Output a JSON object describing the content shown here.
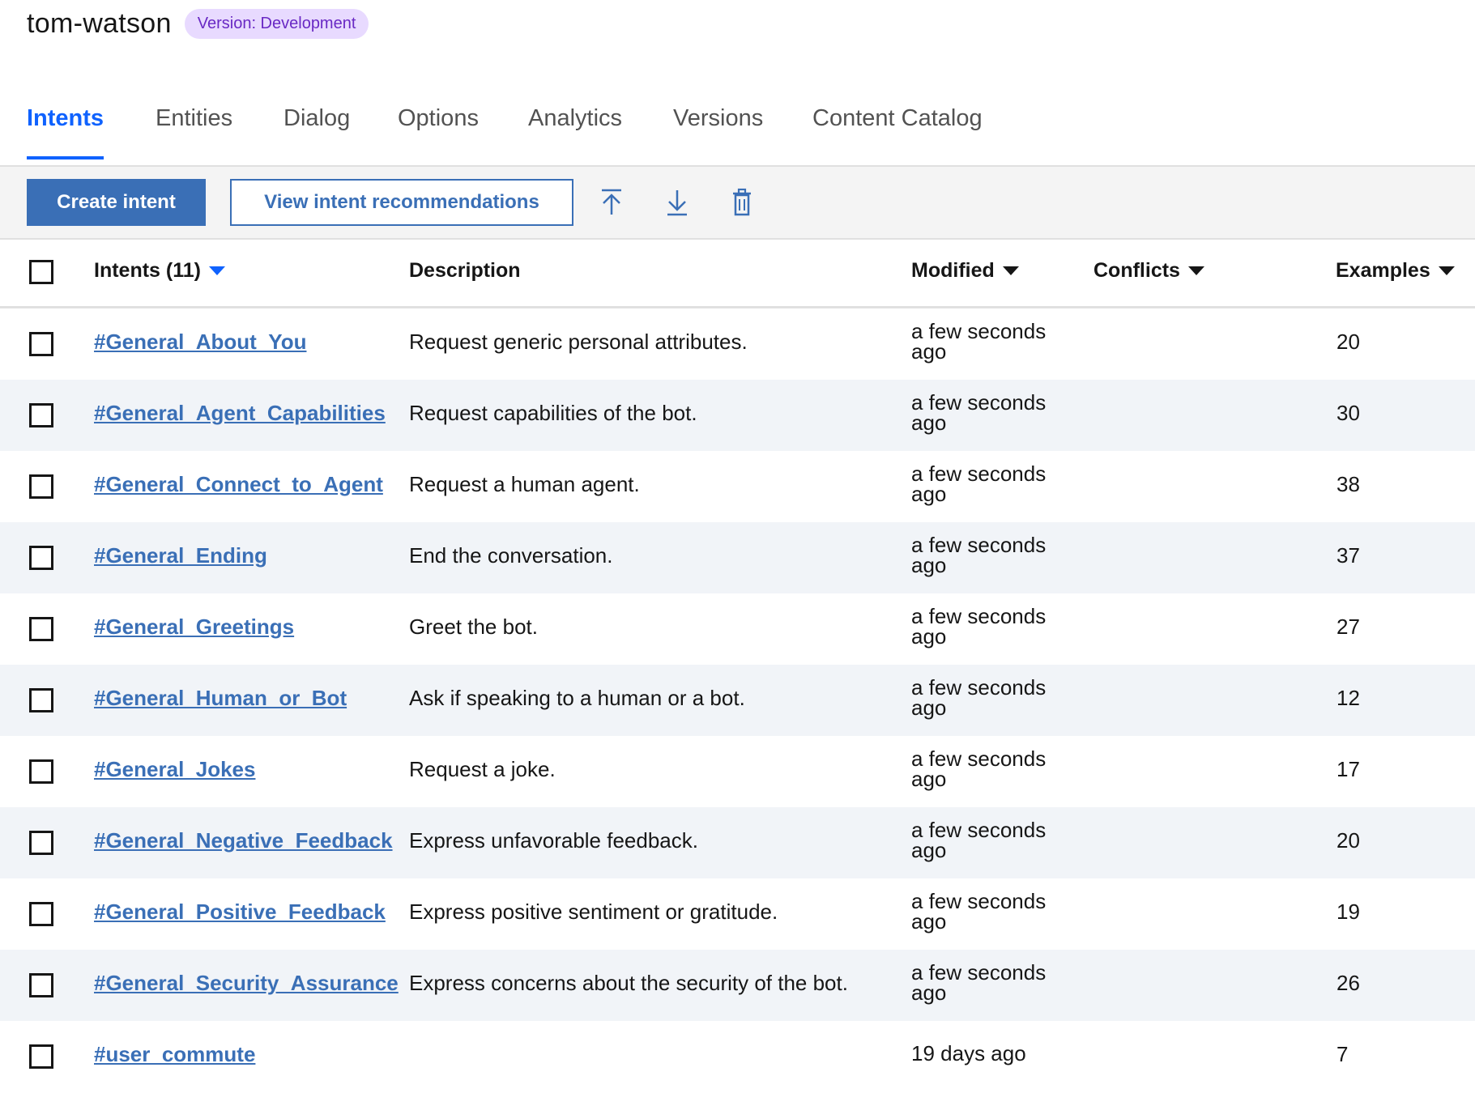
{
  "header": {
    "title": "tom-watson",
    "version_badge": "Version: Development"
  },
  "tabs": [
    {
      "label": "Intents",
      "active": true
    },
    {
      "label": "Entities",
      "active": false
    },
    {
      "label": "Dialog",
      "active": false
    },
    {
      "label": "Options",
      "active": false
    },
    {
      "label": "Analytics",
      "active": false
    },
    {
      "label": "Versions",
      "active": false
    },
    {
      "label": "Content Catalog",
      "active": false
    }
  ],
  "toolbar": {
    "create_label": "Create intent",
    "recommend_label": "View intent recommendations",
    "icons": [
      "upload-icon",
      "download-icon",
      "delete-icon"
    ]
  },
  "table": {
    "columns": {
      "intents": "Intents (11)",
      "description": "Description",
      "modified": "Modified",
      "conflicts": "Conflicts",
      "examples": "Examples"
    },
    "rows": [
      {
        "name": "#General_About_You",
        "description": "Request generic personal attributes.",
        "modified": "a few seconds ago",
        "examples": "20"
      },
      {
        "name": "#General_Agent_Capabilities",
        "description": "Request capabilities of the bot.",
        "modified": "a few seconds ago",
        "examples": "30"
      },
      {
        "name": "#General_Connect_to_Agent",
        "description": "Request a human agent.",
        "modified": "a few seconds ago",
        "examples": "38"
      },
      {
        "name": "#General_Ending",
        "description": "End the conversation.",
        "modified": "a few seconds ago",
        "examples": "37"
      },
      {
        "name": "#General_Greetings",
        "description": "Greet the bot.",
        "modified": "a few seconds ago",
        "examples": "27"
      },
      {
        "name": "#General_Human_or_Bot",
        "description": "Ask if speaking to a human or a bot.",
        "modified": "a few seconds ago",
        "examples": "12"
      },
      {
        "name": "#General_Jokes",
        "description": "Request a joke.",
        "modified": "a few seconds ago",
        "examples": "17"
      },
      {
        "name": "#General_Negative_Feedback",
        "description": "Express unfavorable feedback.",
        "modified": "a few seconds ago",
        "examples": "20"
      },
      {
        "name": "#General_Positive_Feedback",
        "description": "Express positive sentiment or gratitude.",
        "modified": "a few seconds ago",
        "examples": "19"
      },
      {
        "name": "#General_Security_Assurance",
        "description": "Express concerns about the security of the bot.",
        "modified": "a few seconds ago",
        "examples": "26"
      },
      {
        "name": "#user_commute",
        "description": "",
        "modified": "19 days ago",
        "examples": "7"
      }
    ]
  },
  "colors": {
    "accent": "#0f62fe",
    "button": "#3a6fb6",
    "badge_bg": "#e8daff",
    "badge_text": "#6929c4",
    "row_alt": "#f1f4f8"
  }
}
